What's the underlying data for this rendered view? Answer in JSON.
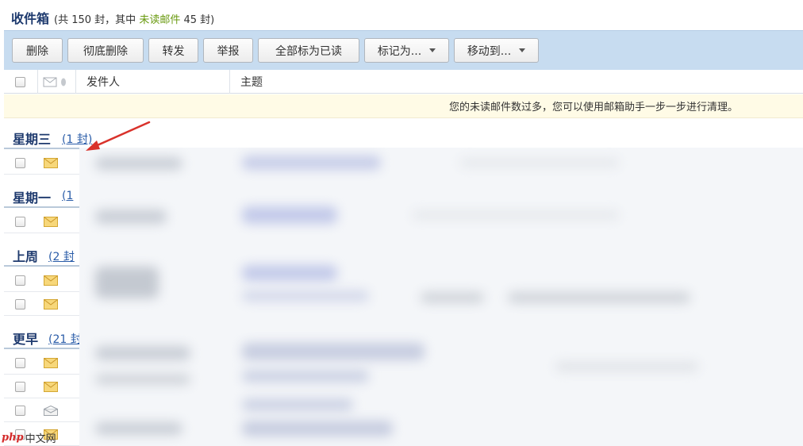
{
  "header": {
    "title": "收件箱",
    "summary_prefix": "(共 150 封，其中",
    "unread_link": "未读邮件",
    "summary_suffix": "45 封)"
  },
  "toolbar": {
    "delete": "删除",
    "delete_permanent": "彻底删除",
    "forward": "转发",
    "report": "举报",
    "mark_all_read": "全部标为已读",
    "mark_as": "标记为...",
    "move_to": "移动到..."
  },
  "columns": {
    "sender": "发件人",
    "subject": "主题"
  },
  "notice": "您的未读邮件数过多，您可以使用邮箱助手一步一步进行清理。",
  "groups": [
    {
      "name": "星期三",
      "count": "(1 封)"
    },
    {
      "name": "星期一",
      "count": "(1"
    },
    {
      "name": "上周",
      "count": "(2 封"
    },
    {
      "name": "更早",
      "count": "(21 封"
    }
  ],
  "watermark": {
    "brand": "php",
    "text": "中文网"
  },
  "colors": {
    "accent": "#1e3a6e",
    "toolbar_bg": "#c7dcf0",
    "notice_bg": "#fffbe6",
    "unread_green": "#6a9a10",
    "annotation_red": "#d9322b"
  }
}
